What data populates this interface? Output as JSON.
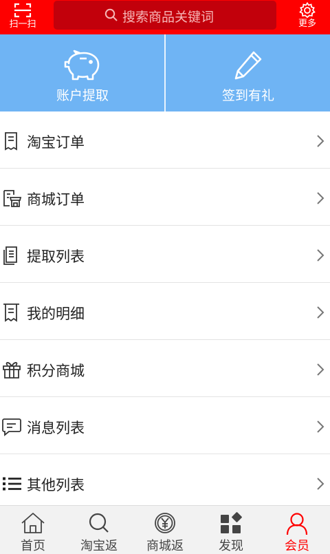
{
  "header": {
    "scan_label": "扫一扫",
    "search_placeholder": "搜索商品关键词",
    "more_label": "更多",
    "colors": {
      "bar": "#fe0000",
      "search_bg": "#c2000b"
    }
  },
  "actions": [
    {
      "label": "账户提取",
      "icon": "piggy-bank-icon"
    },
    {
      "label": "签到有礼",
      "icon": "pencil-icon"
    }
  ],
  "menu": [
    {
      "label": "淘宝订单",
      "icon": "receipt-icon"
    },
    {
      "label": "商城订单",
      "icon": "shop-receipt-icon"
    },
    {
      "label": "提取列表",
      "icon": "document-list-icon"
    },
    {
      "label": "我的明细",
      "icon": "bill-icon"
    },
    {
      "label": "积分商城",
      "icon": "gift-icon"
    },
    {
      "label": "消息列表",
      "icon": "message-icon"
    },
    {
      "label": "其他列表",
      "icon": "list-icon"
    }
  ],
  "nav": {
    "active": "会员",
    "accent": "#ff0000",
    "items": [
      {
        "label": "首页",
        "icon": "home-icon"
      },
      {
        "label": "淘宝返",
        "icon": "search-icon"
      },
      {
        "label": "商城返",
        "icon": "yen-icon"
      },
      {
        "label": "发现",
        "icon": "discover-icon"
      },
      {
        "label": "会员",
        "icon": "user-icon"
      }
    ]
  }
}
